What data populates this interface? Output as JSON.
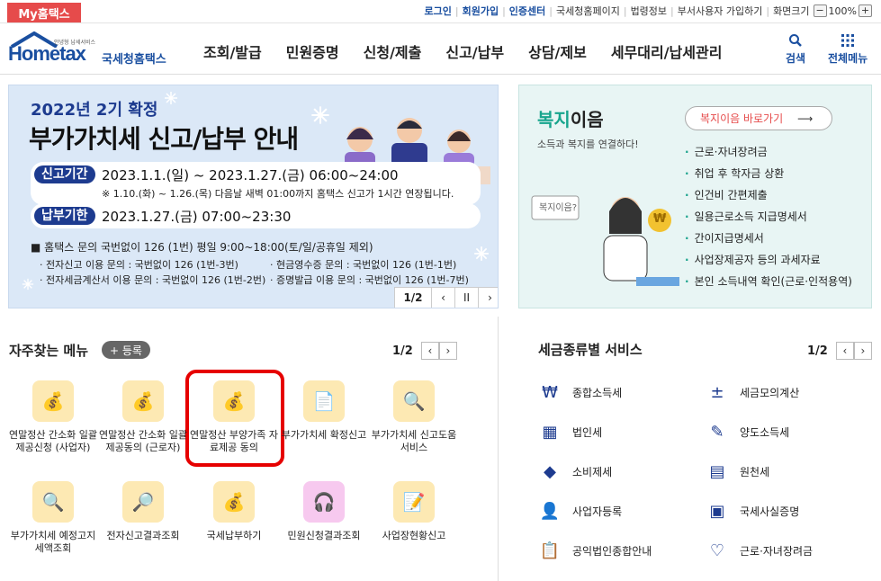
{
  "util": {
    "my_home": "My홈택스",
    "login": "로그인",
    "join": "회원가입",
    "cert": "인증센터",
    "links": [
      "국세청홈페이지",
      "법령정보",
      "부서사용자 가입하기",
      "화면크기"
    ],
    "zoom_minus": "−",
    "zoom": "100%",
    "zoom_plus": "+"
  },
  "header": {
    "logo_small": "안녕형 납세서비스",
    "logo_main": "Hometax",
    "logo_kr": "국세청홈택스",
    "menu": [
      "조회/발급",
      "민원증명",
      "신청/제출",
      "신고/납부",
      "상담/제보",
      "세무대리/납세관리"
    ],
    "search": "검색",
    "all_menu": "전체메뉴"
  },
  "banner": {
    "title1": "2022년 2기 확정",
    "title2": "부가가치세 신고/납부 안내",
    "report_label": "신고기간",
    "report_period": "2023.1.1.(일) ~ 2023.1.27.(금) 06:00~24:00",
    "report_note": "※ 1.10.(화) ~ 1.26.(목) 다음날 새벽 01:00까지 홈택스 신고가 1시간 연장됩니다.",
    "pay_label": "납부기한",
    "pay_period": "2023.1.27.(금) 07:00~23:30",
    "inquiry": "■ 홈택스 문의 국번없이 126 (1번)  평일 9:00~18:00(토/일/공휴일 제외)",
    "inq1": "· 전자신고 이용 문의 : 국번없이 126 (1번-3번)",
    "inq2": "· 현금영수증 문의 : 국번없이 126 (1번-1번)",
    "inq3": "· 전자세금계산서 이용 문의 : 국번없이 126 (1번-2번)",
    "inq4": "· 증명발급 이용 문의 : 국번없이 126 (1번-7번)",
    "page": "1/2"
  },
  "welfare": {
    "title_a": "복지",
    "title_b": "이음",
    "subtitle": "소득과 복지를 연결하다!",
    "btn": "복지이음 바로가기",
    "items": [
      "근로·자녀장려금",
      "취업 후 학자금 상환",
      "인건비 간편제출",
      "일용근로소득 지급명세서",
      "간이지급명세서",
      "사업장제공자 등의 과세자료",
      "본인 소득내역 확인(근로·인적용역)"
    ],
    "bubble": "복지이음?",
    "coin": "₩"
  },
  "freq": {
    "title": "자주찾는 메뉴",
    "add": "+ 등록",
    "page": "1/2",
    "items": [
      "연말정산 간소화 일괄제공신청 (사업자)",
      "연말정산 간소화 일괄제공동의 (근로자)",
      "연말정산 부양가족 자료제공 동의",
      "부가가치세 확정신고",
      "부가가치세 신고도움 서비스",
      "부가가치세 예정고지 세액조회",
      "전자신고결과조회",
      "국세납부하기",
      "민원신청결과조회",
      "사업장현황신고"
    ]
  },
  "tax": {
    "title": "세금종류별 서비스",
    "page": "1/2",
    "left": [
      "종합소득세",
      "법인세",
      "소비제세",
      "사업자등록",
      "공익법인종합안내"
    ],
    "right": [
      "세금모의계산",
      "양도소득세",
      "원천세",
      "국세사실증명",
      "근로·자녀장려금"
    ]
  }
}
